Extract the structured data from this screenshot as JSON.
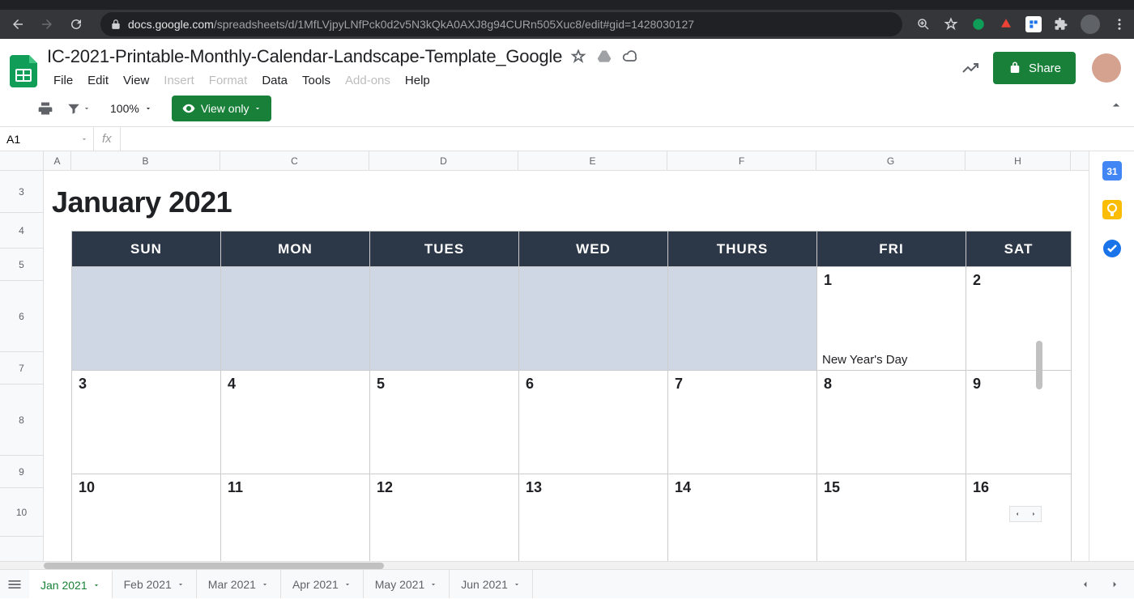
{
  "browser": {
    "url_host": "docs.google.com",
    "url_path": "/spreadsheets/d/1MfLVjpyLNfPck0d2v5N3kQkA0AXJ8g94CURn505Xuc8/edit#gid=1428030127"
  },
  "doc": {
    "title": "IC-2021-Printable-Monthly-Calendar-Landscape-Template_Google",
    "menu": [
      "File",
      "Edit",
      "View",
      "Insert",
      "Format",
      "Data",
      "Tools",
      "Add-ons",
      "Help"
    ],
    "menu_disabled": [
      "Insert",
      "Format",
      "Add-ons"
    ],
    "share_label": "Share"
  },
  "toolbar": {
    "zoom": "100%",
    "view_only": "View only"
  },
  "formula": {
    "cell_ref": "A1",
    "fx": "fx",
    "value": ""
  },
  "columns": [
    "A",
    "B",
    "C",
    "D",
    "E",
    "F",
    "G",
    "H"
  ],
  "rows_visible": [
    "3",
    "4",
    "5",
    "6",
    "7",
    "8",
    "9",
    "10"
  ],
  "calendar": {
    "title": "January 2021",
    "day_headers": [
      "SUN",
      "MON",
      "TUES",
      "WED",
      "THURS",
      "FRI",
      "SAT"
    ],
    "weeks": [
      [
        {
          "blank": true
        },
        {
          "blank": true
        },
        {
          "blank": true
        },
        {
          "blank": true
        },
        {
          "blank": true
        },
        {
          "day": "1",
          "event": "New Year's Day"
        },
        {
          "day": "2"
        }
      ],
      [
        {
          "day": "3"
        },
        {
          "day": "4"
        },
        {
          "day": "5"
        },
        {
          "day": "6"
        },
        {
          "day": "7"
        },
        {
          "day": "8"
        },
        {
          "day": "9"
        }
      ],
      [
        {
          "day": "10"
        },
        {
          "day": "11"
        },
        {
          "day": "12"
        },
        {
          "day": "13"
        },
        {
          "day": "14"
        },
        {
          "day": "15"
        },
        {
          "day": "16"
        }
      ]
    ]
  },
  "sheet_tabs": [
    "Jan 2021",
    "Feb 2021",
    "Mar 2021",
    "Apr 2021",
    "May 2021",
    "Jun 2021"
  ],
  "active_sheet": "Jan 2021",
  "side_apps": {
    "calendar_color": "#4285f4",
    "keep_color": "#fbbc04",
    "tasks_color": "#1a73e8"
  }
}
